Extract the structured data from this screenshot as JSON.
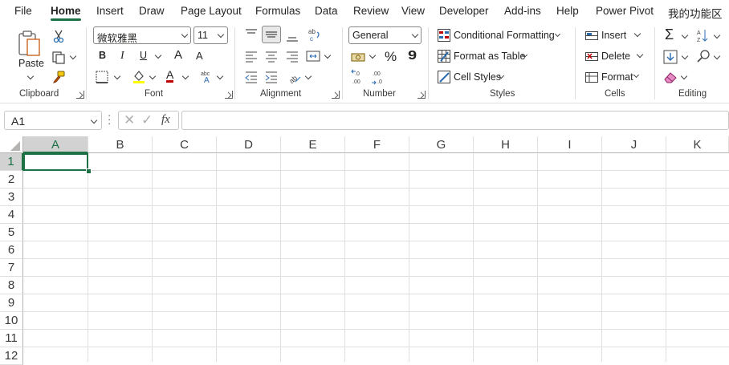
{
  "tabs": [
    "File",
    "Home",
    "Insert",
    "Draw",
    "Page Layout",
    "Formulas",
    "Data",
    "Review",
    "View",
    "Developer",
    "Add-ins",
    "Help",
    "Power Pivot",
    "我的功能区"
  ],
  "active_tab": "Home",
  "accent_color": "#1e7145",
  "clipboard": {
    "paste_label": "Paste",
    "group_label": "Clipboard"
  },
  "font": {
    "family": "微软雅黑",
    "size": "11",
    "bold": "B",
    "italic": "I",
    "underline": "U",
    "grow": "A",
    "shrink": "A",
    "font_color": "A",
    "group_label": "Font"
  },
  "alignment": {
    "group_label": "Alignment"
  },
  "number": {
    "format": "General",
    "percent": "%",
    "comma": "9",
    "group_label": "Number"
  },
  "styles": {
    "conditional": "Conditional Formatting",
    "format_table": "Format as Table",
    "cell_styles": "Cell Styles",
    "group_label": "Styles"
  },
  "cells": {
    "insert": "Insert",
    "delete": "Delete",
    "format": "Format",
    "group_label": "Cells"
  },
  "editing": {
    "group_label": "Editing"
  },
  "formula_bar": {
    "name_box": "A1",
    "fx": "fx",
    "value": ""
  },
  "columns": [
    "A",
    "B",
    "C",
    "D",
    "E",
    "F",
    "G",
    "H",
    "I",
    "J",
    "K"
  ],
  "rows": [
    "1",
    "2",
    "3",
    "4",
    "5",
    "6",
    "7",
    "8",
    "9",
    "10",
    "11",
    "12"
  ],
  "selected_cell": "A1"
}
